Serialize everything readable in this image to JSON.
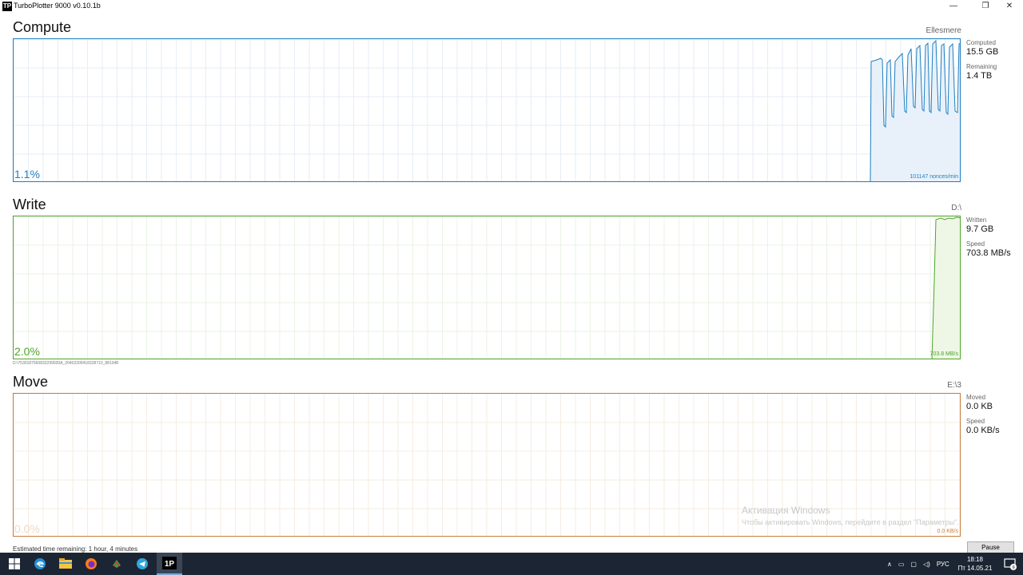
{
  "window": {
    "title": "TurboPlotter 9000 v0.10.1b",
    "icon_text": "TP",
    "controls": [
      "—",
      "❐",
      "✕"
    ]
  },
  "compute": {
    "title": "Compute",
    "device": "Ellesmere",
    "percent": "1.1%",
    "rate": "101147 nonces/min",
    "stats": [
      {
        "label": "Computed",
        "value": "15.5 GB"
      },
      {
        "label": "Remaining",
        "value": "1.4 TB"
      }
    ],
    "color": "#1d7ec2",
    "fill": "#e8f1fa"
  },
  "write": {
    "title": "Write",
    "device": "D:\\",
    "percent": "2.0%",
    "rate": "703.8 MB/s",
    "path": "D:\\7530187560832299930A_20402209418328710_881048",
    "stats": [
      {
        "label": "Written",
        "value": "9.7 GB"
      },
      {
        "label": "Speed",
        "value": "703.8 MB/s"
      }
    ],
    "color": "#4ea52a",
    "fill": "#eef7e6"
  },
  "move": {
    "title": "Move",
    "device": "E:\\3",
    "percent": "0.0%",
    "rate": "0.0 KB/s",
    "stats": [
      {
        "label": "Moved",
        "value": "0.0 KB"
      },
      {
        "label": "Speed",
        "value": "0.0 KB/s"
      }
    ],
    "color": "#c77d3b"
  },
  "status": {
    "eta": "Estimated time remaining: 1 hour, 4 minutes",
    "pause_label": "Pause"
  },
  "watermark": {
    "line1": "Активация Windows",
    "line2": "Чтобы активировать Windows, перейдите в раздел \"Параметры\"."
  },
  "taskbar": {
    "apps": [
      "windows-start",
      "edge",
      "file-explorer",
      "firefox",
      "app-green",
      "telegram",
      "turboplotter"
    ],
    "tray_lang": "РУС",
    "clock_time": "18:18",
    "clock_date": "Пт 14.05.21",
    "notification_count": "9"
  }
}
